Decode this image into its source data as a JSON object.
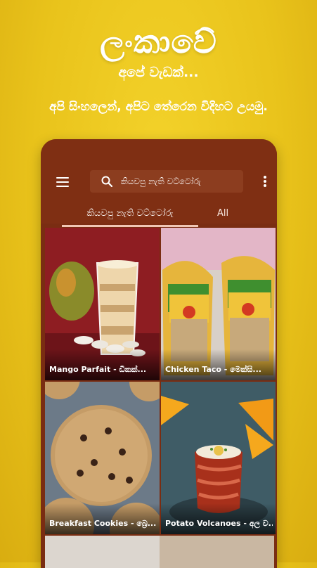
{
  "promo": {
    "title": "ලංකාවේ",
    "subtitle": "අපේ වැඩක්...",
    "tagline": "අපි සිංහලෙන්, අපිට තේරෙන විදිහට උයමු."
  },
  "app": {
    "search": {
      "placeholder": "කියවපු නැති වට්ටෝරු"
    },
    "tabs": [
      {
        "label": "කියවපු නැති වට්ටෝරු",
        "active": true
      },
      {
        "label": "All",
        "active": false
      }
    ],
    "recipes": [
      {
        "title": "Mango Parfait - ඩීකක්..."
      },
      {
        "title": "Chicken Taco - මෙක්සි..."
      },
      {
        "title": "Breakfast Cookies - බ්‍රෙ..."
      },
      {
        "title": "Potato Volcanoes - අල ව..."
      }
    ]
  },
  "colors": {
    "background": "#e9c31b",
    "appbar": "#7f2f13",
    "tab_indicator": "#f0c6b4"
  }
}
